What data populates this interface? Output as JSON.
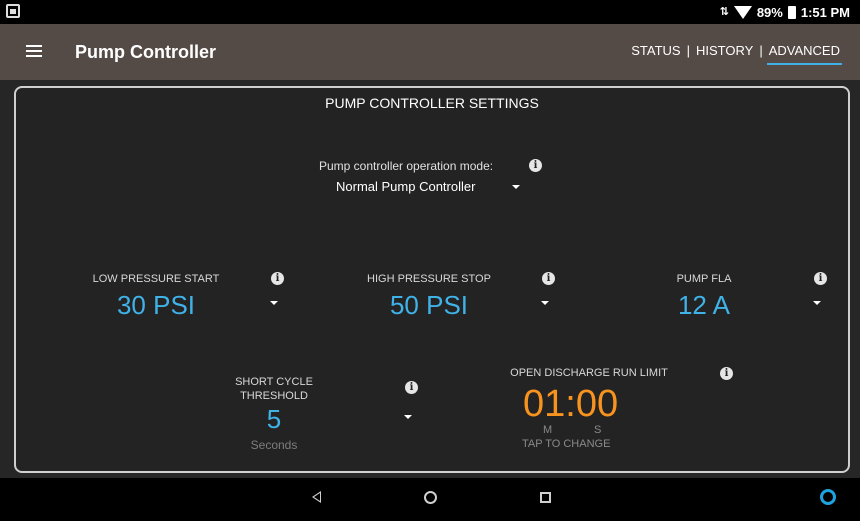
{
  "status_bar": {
    "battery": "89%",
    "time": "1:51 PM"
  },
  "app_bar": {
    "title": "Pump Controller",
    "tabs": [
      {
        "label": "STATUS"
      },
      {
        "label": "HISTORY"
      },
      {
        "label": "ADVANCED"
      }
    ],
    "separator": "|",
    "active_tab": "ADVANCED"
  },
  "settings": {
    "title": "PUMP CONTROLLER SETTINGS",
    "mode": {
      "label": "Pump controller operation mode:",
      "value": "Normal Pump Controller"
    },
    "low_pressure_start": {
      "label": "LOW PRESSURE START",
      "value": "30 PSI"
    },
    "high_pressure_stop": {
      "label": "HIGH PRESSURE STOP",
      "value": "50 PSI"
    },
    "pump_fla": {
      "label": "PUMP FLA",
      "value": "12 A"
    },
    "short_cycle": {
      "label_line1": "SHORT CYCLE",
      "label_line2": "THRESHOLD",
      "value": "5",
      "unit": "Seconds"
    },
    "open_discharge": {
      "label": "OPEN DISCHARGE RUN LIMIT",
      "value": "01:00",
      "m_label": "M",
      "s_label": "S",
      "hint": "TAP TO CHANGE"
    }
  },
  "colors": {
    "accent_blue": "#3fb2e8",
    "accent_orange": "#f7931e",
    "app_bar": "#544a46"
  }
}
